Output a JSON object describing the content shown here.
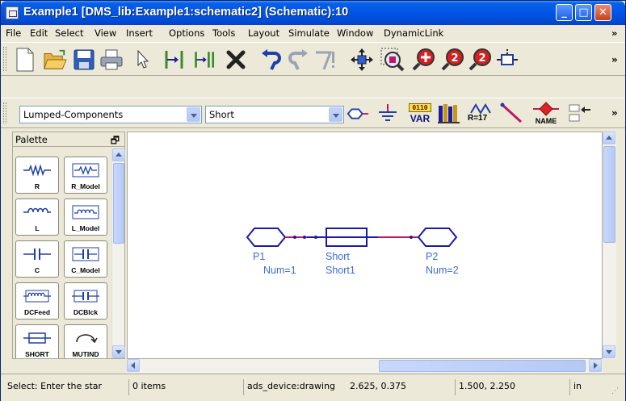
{
  "window": {
    "title": "Example1 [DMS_lib:Example1:schematic2] (Schematic):10",
    "minimize": "_",
    "maximize": "□",
    "close": "✕"
  },
  "menu": {
    "items": [
      "File",
      "Edit",
      "Select",
      "View",
      "Insert",
      "Options",
      "Tools",
      "Layout",
      "Simulate",
      "Window",
      "DynamicLink"
    ],
    "overflow": "»"
  },
  "toolbar1": {
    "icons": [
      "new-icon",
      "open-icon",
      "save-icon",
      "print-icon",
      "pointer-icon",
      "insert-wire-icon",
      "insert-pin-icon",
      "delete-icon",
      "undo-icon",
      "redo-icon",
      "rotate-icon",
      "move-icon",
      "zoom-area-icon",
      "zoom-in-icon",
      "zoom-plus2-icon",
      "zoom-minus2-icon",
      "port-icon"
    ],
    "overflow": "»"
  },
  "toolbar2": {
    "library_select": "Lumped-Components",
    "component_select": "Short",
    "var_label_top": "0110",
    "var_label": "VAR",
    "r17_label": "R=17",
    "name_label": "NAME",
    "overflow": "»"
  },
  "palette": {
    "title": "Palette",
    "pin": "🗗",
    "items": [
      {
        "label": "R",
        "icon": "resistor-icon"
      },
      {
        "label": "R_Model",
        "icon": "resistor-model-icon"
      },
      {
        "label": "L",
        "icon": "inductor-icon"
      },
      {
        "label": "L_Model",
        "icon": "inductor-model-icon"
      },
      {
        "label": "C",
        "icon": "capacitor-icon"
      },
      {
        "label": "C_Model",
        "icon": "capacitor-model-icon"
      },
      {
        "label": "DCFeed",
        "icon": "dcfeed-icon"
      },
      {
        "label": "DCBlck",
        "icon": "dcblock-icon"
      },
      {
        "label": "SHORT",
        "icon": "short-icon"
      },
      {
        "label": "MUTIND",
        "icon": "mutind-icon"
      }
    ]
  },
  "schematic": {
    "port1": {
      "name": "P1",
      "num": "Num=1"
    },
    "short": {
      "type": "Short",
      "name": "Short1"
    },
    "port2": {
      "name": "P2",
      "num": "Num=2"
    },
    "colors": {
      "component": "#1a1aa8",
      "wire": "#c0185e",
      "label": "#3b6cd6"
    }
  },
  "status": {
    "message": "Select: Enter the star",
    "items": "0 items",
    "context": "ads_device:drawing",
    "coord1": "2.625, 0.375",
    "coord2": "1.500, 2.250",
    "units": "in"
  }
}
